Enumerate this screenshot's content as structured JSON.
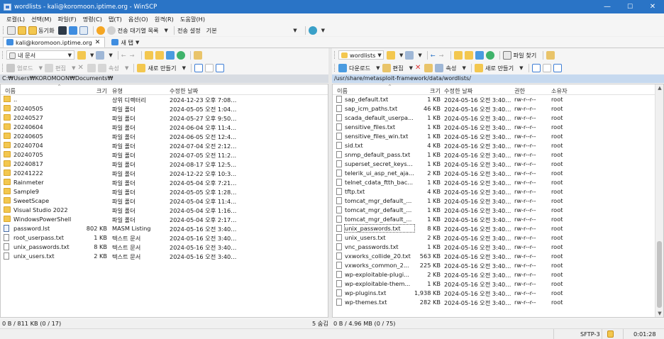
{
  "window": {
    "title": "wordlists - kali@koromoon.iptime.org - WinSCP",
    "minimize": "—",
    "maximize": "☐",
    "close": "✕"
  },
  "menu": [
    "로컬(L)",
    "선택(M)",
    "파일(F)",
    "명령(C)",
    "탭(T)",
    "옵션(O)",
    "원격(R)",
    "도움말(H)"
  ],
  "toolbar": {
    "sync_label": "동기화",
    "queue_label": "전송 대기열 목록",
    "transfer_settings_label": "전송 설정",
    "transfer_settings_value": "기본"
  },
  "tabs": [
    {
      "label": "kali@koromoon.iptime.org"
    },
    {
      "label": "새 탭"
    }
  ],
  "colors": {
    "titlebar": "#2a74c6",
    "folder": "#f3c74f",
    "path_active": "#c6d9ef"
  },
  "left": {
    "location_label": "내 문서",
    "upload_label": "업로드",
    "edit_label": "편집",
    "properties_label": "속성",
    "new_label": "새로 만들기",
    "path": "C:₩Users₩KOROMOON₩Documents₩",
    "columns": {
      "name": "이름",
      "size": "크기",
      "type": "유형",
      "modified": "수정한 날짜"
    },
    "rows": [
      {
        "name": "..",
        "size": "",
        "type": "상위 디렉터리",
        "date": "2024-12-23 오후 7:08:...",
        "icon": "updir"
      },
      {
        "name": "20240505",
        "size": "",
        "type": "파일 폴더",
        "date": "2024-05-05 오전 1:04:...",
        "icon": "folder"
      },
      {
        "name": "20240527",
        "size": "",
        "type": "파일 폴더",
        "date": "2024-05-27 오후 9:50:...",
        "icon": "folder"
      },
      {
        "name": "20240604",
        "size": "",
        "type": "파일 폴더",
        "date": "2024-06-04 오후 11:4...",
        "icon": "folder"
      },
      {
        "name": "20240605",
        "size": "",
        "type": "파일 폴더",
        "date": "2024-06-05 오전 12:4...",
        "icon": "folder"
      },
      {
        "name": "20240704",
        "size": "",
        "type": "파일 폴더",
        "date": "2024-07-04 오전 2:12:...",
        "icon": "folder"
      },
      {
        "name": "20240705",
        "size": "",
        "type": "파일 폴더",
        "date": "2024-07-05 오전 11:2...",
        "icon": "folder"
      },
      {
        "name": "20240817",
        "size": "",
        "type": "파일 폴더",
        "date": "2024-08-17 오후 12:5...",
        "icon": "folder"
      },
      {
        "name": "20241222",
        "size": "",
        "type": "파일 폴더",
        "date": "2024-12-22 오후 10:3...",
        "icon": "folder"
      },
      {
        "name": "Rainmeter",
        "size": "",
        "type": "파일 폴더",
        "date": "2024-05-04 오후 7:21:...",
        "icon": "folder"
      },
      {
        "name": "Sample9",
        "size": "",
        "type": "파일 폴더",
        "date": "2024-05-05 오후 1:28:...",
        "icon": "folder"
      },
      {
        "name": "SweetScape",
        "size": "",
        "type": "파일 폴더",
        "date": "2024-05-04 오후 11:4...",
        "icon": "folder"
      },
      {
        "name": "Visual Studio 2022",
        "size": "",
        "type": "파일 폴더",
        "date": "2024-05-04 오후 1:16:...",
        "icon": "folder"
      },
      {
        "name": "WindowsPowerShell",
        "size": "",
        "type": "파일 폴더",
        "date": "2024-05-04 오후 2:17:...",
        "icon": "folder"
      },
      {
        "name": "password.lst",
        "size": "802 KB",
        "type": "MASM Listing",
        "date": "2024-05-16 오전 3:40:...",
        "icon": "lst"
      },
      {
        "name": "root_userpass.txt",
        "size": "1 KB",
        "type": "텍스트 문서",
        "date": "2024-05-16 오전 3:40:...",
        "icon": "file"
      },
      {
        "name": "unix_passwords.txt",
        "size": "8 KB",
        "type": "텍스트 문서",
        "date": "2024-05-16 오전 3:40:...",
        "icon": "file"
      },
      {
        "name": "unix_users.txt",
        "size": "2 KB",
        "type": "텍스트 문서",
        "date": "2024-05-16 오전 3:40:...",
        "icon": "file"
      }
    ],
    "status": "0 B / 811 KB (0 / 17)",
    "hidden_count": "5 숨김"
  },
  "right": {
    "location_label": "wordlists",
    "find_label": "파일 찾기",
    "download_label": "다운로드",
    "edit_label": "편집",
    "properties_label": "속성",
    "new_label": "새로 만들기",
    "path": "/usr/share/metasploit-framework/data/wordlists/",
    "columns": {
      "name": "이름",
      "size": "크기",
      "modified": "수정한 날짜",
      "rights": "권한",
      "owner": "소유자"
    },
    "rows": [
      {
        "name": "sap_default.txt",
        "size": "1 KB",
        "date": "2024-05-16 오전 3:40:...",
        "rights": "rw-r--r--",
        "owner": "root"
      },
      {
        "name": "sap_icm_paths.txt",
        "size": "46 KB",
        "date": "2024-05-16 오전 3:40:...",
        "rights": "rw-r--r--",
        "owner": "root"
      },
      {
        "name": "scada_default_userpa...",
        "size": "1 KB",
        "date": "2024-05-16 오전 3:40:...",
        "rights": "rw-r--r--",
        "owner": "root"
      },
      {
        "name": "sensitive_files.txt",
        "size": "1 KB",
        "date": "2024-05-16 오전 3:40:...",
        "rights": "rw-r--r--",
        "owner": "root"
      },
      {
        "name": "sensitive_files_win.txt",
        "size": "1 KB",
        "date": "2024-05-16 오전 3:40:...",
        "rights": "rw-r--r--",
        "owner": "root"
      },
      {
        "name": "sid.txt",
        "size": "4 KB",
        "date": "2024-05-16 오전 3:40:...",
        "rights": "rw-r--r--",
        "owner": "root"
      },
      {
        "name": "snmp_default_pass.txt",
        "size": "1 KB",
        "date": "2024-05-16 오전 3:40:...",
        "rights": "rw-r--r--",
        "owner": "root"
      },
      {
        "name": "superset_secret_keys.t...",
        "size": "1 KB",
        "date": "2024-05-16 오전 3:40:...",
        "rights": "rw-r--r--",
        "owner": "root"
      },
      {
        "name": "telerik_ui_asp_net_aja...",
        "size": "2 KB",
        "date": "2024-05-16 오전 3:40:...",
        "rights": "rw-r--r--",
        "owner": "root"
      },
      {
        "name": "telnet_cdata_ftth_bac...",
        "size": "1 KB",
        "date": "2024-05-16 오전 3:40:...",
        "rights": "rw-r--r--",
        "owner": "root"
      },
      {
        "name": "tftp.txt",
        "size": "4 KB",
        "date": "2024-05-16 오전 3:40:...",
        "rights": "rw-r--r--",
        "owner": "root"
      },
      {
        "name": "tomcat_mgr_default_...",
        "size": "1 KB",
        "date": "2024-05-16 오전 3:40:...",
        "rights": "rw-r--r--",
        "owner": "root"
      },
      {
        "name": "tomcat_mgr_default_...",
        "size": "1 KB",
        "date": "2024-05-16 오전 3:40:...",
        "rights": "rw-r--r--",
        "owner": "root"
      },
      {
        "name": "tomcat_mgr_default_...",
        "size": "1 KB",
        "date": "2024-05-16 오전 3:40:...",
        "rights": "rw-r--r--",
        "owner": "root"
      },
      {
        "name": "unix_passwords.txt",
        "size": "8 KB",
        "date": "2024-05-16 오전 3:40:...",
        "rights": "rw-r--r--",
        "owner": "root",
        "focus": true
      },
      {
        "name": "unix_users.txt",
        "size": "2 KB",
        "date": "2024-05-16 오전 3:40:...",
        "rights": "rw-r--r--",
        "owner": "root"
      },
      {
        "name": "vnc_passwords.txt",
        "size": "1 KB",
        "date": "2024-05-16 오전 3:40:...",
        "rights": "rw-r--r--",
        "owner": "root"
      },
      {
        "name": "vxworks_collide_20.txt",
        "size": "563 KB",
        "date": "2024-05-16 오전 3:40:...",
        "rights": "rw-r--r--",
        "owner": "root"
      },
      {
        "name": "vxworks_common_2...",
        "size": "225 KB",
        "date": "2024-05-16 오전 3:40:...",
        "rights": "rw-r--r--",
        "owner": "root"
      },
      {
        "name": "wp-exploitable-plugi...",
        "size": "2 KB",
        "date": "2024-05-16 오전 3:40:...",
        "rights": "rw-r--r--",
        "owner": "root"
      },
      {
        "name": "wp-exploitable-them...",
        "size": "1 KB",
        "date": "2024-05-16 오전 3:40:...",
        "rights": "rw-r--r--",
        "owner": "root"
      },
      {
        "name": "wp-plugins.txt",
        "size": "1,938 KB",
        "date": "2024-05-16 오전 3:40:...",
        "rights": "rw-r--r--",
        "owner": "root"
      },
      {
        "name": "wp-themes.txt",
        "size": "282 KB",
        "date": "2024-05-16 오전 3:40:...",
        "rights": "rw-r--r--",
        "owner": "root"
      }
    ],
    "status": "0 B / 4.96 MB (0 / 75)"
  },
  "status": {
    "protocol": "SFTP-3",
    "elapsed": "0:01:28"
  }
}
